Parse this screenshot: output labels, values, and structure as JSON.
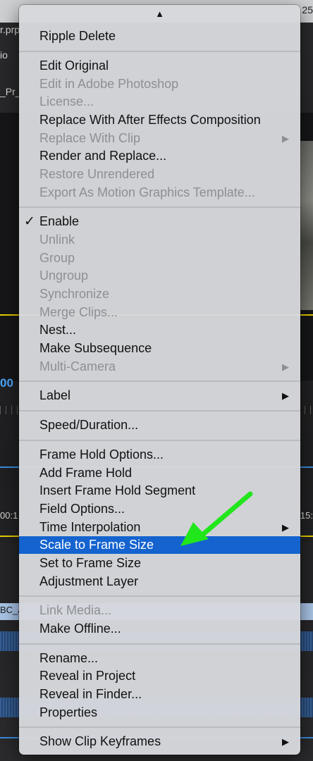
{
  "background": {
    "partial_texts": {
      "filename": "r.prp",
      "top_right_number": "25",
      "panel_label": "io",
      "sequence_name": "_Pr_",
      "timecode_blue": "00",
      "timeline_left": "00:1",
      "timeline_right": "15:",
      "clip_name": "BC_A"
    }
  },
  "context_menu": {
    "scroll_indicator": "▲",
    "submenu_glyph": "▶",
    "check_glyph": "✓",
    "items": [
      {
        "label": "Ripple Delete",
        "enabled": true
      },
      {
        "label": "Edit Original",
        "enabled": true
      },
      {
        "label": "Edit in Adobe Photoshop",
        "enabled": false
      },
      {
        "label": "License...",
        "enabled": false
      },
      {
        "label": "Replace With After Effects Composition",
        "enabled": true
      },
      {
        "label": "Replace With Clip",
        "enabled": false,
        "submenu": true
      },
      {
        "label": "Render and Replace...",
        "enabled": true
      },
      {
        "label": "Restore Unrendered",
        "enabled": false
      },
      {
        "label": "Export As Motion Graphics Template...",
        "enabled": false
      },
      {
        "label": "Enable",
        "enabled": true,
        "checked": true
      },
      {
        "label": "Unlink",
        "enabled": false
      },
      {
        "label": "Group",
        "enabled": false
      },
      {
        "label": "Ungroup",
        "enabled": false
      },
      {
        "label": "Synchronize",
        "enabled": false
      },
      {
        "label": "Merge Clips...",
        "enabled": false
      },
      {
        "label": "Nest...",
        "enabled": true
      },
      {
        "label": "Make Subsequence",
        "enabled": true
      },
      {
        "label": "Multi-Camera",
        "enabled": false,
        "submenu": true
      },
      {
        "label": "Label",
        "enabled": true,
        "submenu": true
      },
      {
        "label": "Speed/Duration...",
        "enabled": true
      },
      {
        "label": "Frame Hold Options...",
        "enabled": true
      },
      {
        "label": "Add Frame Hold",
        "enabled": true
      },
      {
        "label": "Insert Frame Hold Segment",
        "enabled": true
      },
      {
        "label": "Field Options...",
        "enabled": true
      },
      {
        "label": "Time Interpolation",
        "enabled": true,
        "submenu": true
      },
      {
        "label": "Scale to Frame Size",
        "enabled": true,
        "highlighted": true
      },
      {
        "label": "Set to Frame Size",
        "enabled": true
      },
      {
        "label": "Adjustment Layer",
        "enabled": true
      },
      {
        "label": "Link Media...",
        "enabled": false
      },
      {
        "label": "Make Offline...",
        "enabled": true
      },
      {
        "label": "Rename...",
        "enabled": true
      },
      {
        "label": "Reveal in Project",
        "enabled": true
      },
      {
        "label": "Reveal in Finder...",
        "enabled": true
      },
      {
        "label": "Properties",
        "enabled": true
      },
      {
        "label": "Show Clip Keyframes",
        "enabled": true,
        "submenu": true
      }
    ]
  },
  "colors": {
    "menu_background": "#d6d8dc",
    "highlight": "#1463cf",
    "disabled_text": "#8d8f93",
    "annotation_arrow": "#22e61c",
    "playhead_yellow": "#e9d000"
  },
  "icons": {
    "scroll_up": "triangle-up-icon",
    "submenu": "submenu-triangle-icon",
    "check": "checkmark-icon",
    "annotation": "green-arrow-icon"
  }
}
